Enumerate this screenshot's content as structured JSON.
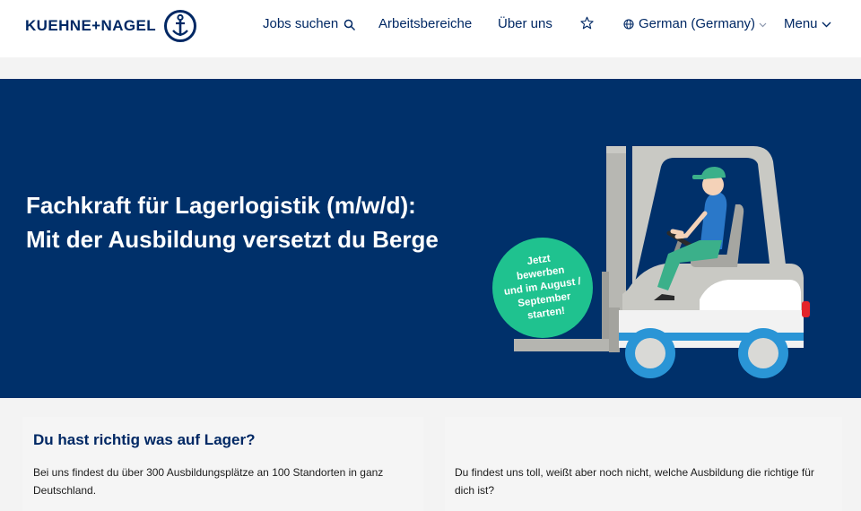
{
  "header": {
    "logo_text": "KUEHNE+NAGEL",
    "nav": {
      "jobs": "Jobs suchen",
      "areas": "Arbeitsbereiche",
      "about": "Über uns",
      "language": "German (Germany)",
      "menu": "Menu"
    }
  },
  "hero": {
    "title_line1": "Fachkraft für Lagerlogistik (m/w/d):",
    "title_line2": "Mit der Ausbildung versetzt du Berge",
    "badge": [
      "Jetzt",
      "bewerben",
      "und im August /",
      "September",
      "starten!"
    ]
  },
  "cards": {
    "left": {
      "title": "Du hast richtig was auf Lager?",
      "text_line1": "Bei uns findest du über 300 Ausbildungsplätze an 100 Standorten in ganz",
      "text_line2": "Deutschland."
    },
    "right": {
      "text_line1": "Du findest uns toll, weißt aber noch nicht, welche Ausbildung die richtige für",
      "text_line2": "dich ist?"
    }
  },
  "colors": {
    "brand_blue": "#002864",
    "hero_bg": "#00306a",
    "badge_green": "#1fc28f",
    "wheel_blue": "#2a95d6"
  }
}
